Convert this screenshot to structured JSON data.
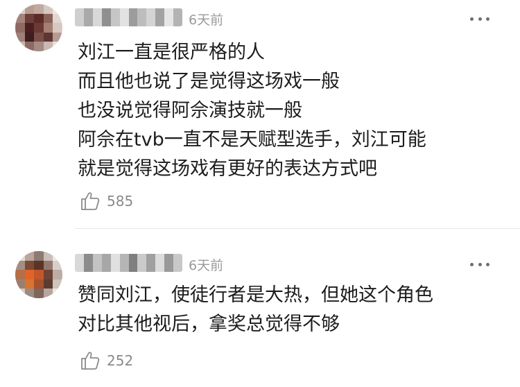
{
  "comments": [
    {
      "time": "6天前",
      "lines": [
        "刘江一直是很严格的人",
        "而且他也说了是觉得这场戏一般",
        "也没说觉得阿佘演技就一般",
        "阿佘在tvb一直不是天赋型选手，刘江可能",
        "就是觉得这场戏有更好的表达方式吧"
      ],
      "likes": "585",
      "like_icon": "thumbs-up-icon",
      "more_icon": "more-dots-icon"
    },
    {
      "time": "6天前",
      "lines": [
        "赞同刘江，使徒行者是大热，但她这个角色",
        "对比其他视后，拿奖总觉得不够"
      ],
      "likes": "252",
      "like_icon": "thumbs-up-icon",
      "more_icon": "more-dots-icon"
    }
  ],
  "colors": {
    "time_text": "#9a9a9a",
    "body_text": "#1c1c1c",
    "like_count": "#8a8a8a",
    "divider": "#e6e6e6"
  }
}
